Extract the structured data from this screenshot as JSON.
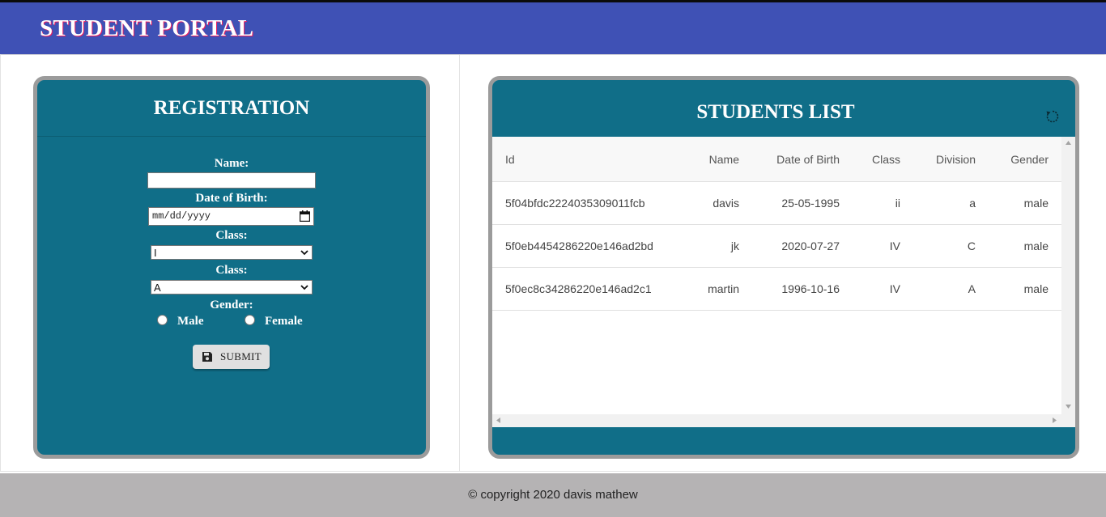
{
  "header": {
    "title": "STUDENT PORTAL"
  },
  "registration": {
    "title": "REGISTRATION",
    "name_label": "Name:",
    "name_value": "",
    "dob_label": "Date of Birth:",
    "dob_placeholder": "mm/dd/yyyy",
    "class_label": "Class:",
    "class_value": "I",
    "division_label": "Class:",
    "division_value": "A",
    "gender_label": "Gender:",
    "gender_options": [
      "Male",
      "Female"
    ],
    "submit_label": "SUBMIT"
  },
  "students": {
    "title": "STUDENTS LIST",
    "columns": [
      "Id",
      "Name",
      "Date of Birth",
      "Class",
      "Division",
      "Gender"
    ],
    "rows": [
      [
        "5f04bfdc2224035309011fcb",
        "davis",
        "25-05-1995",
        "ii",
        "a",
        "male"
      ],
      [
        "5f0eb4454286220e146ad2bd",
        "jk",
        "2020-07-27",
        "IV",
        "C",
        "male"
      ],
      [
        "5f0ec8c34286220e146ad2c1",
        "martin",
        "1996-10-16",
        "IV",
        "A",
        "male"
      ]
    ]
  },
  "footer": {
    "text": "© copyright 2020 davis mathew"
  },
  "colors": {
    "header_bg": "#3f51b5",
    "card_bg": "#106e88",
    "card_border": "#9b9b9b",
    "footer_bg": "#b5b3b4"
  }
}
